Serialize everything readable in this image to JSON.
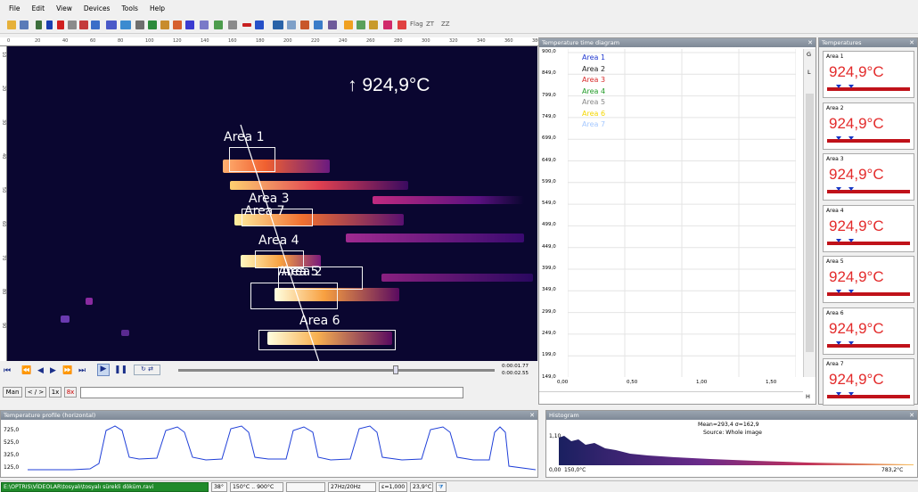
{
  "menu": [
    "File",
    "Edit",
    "View",
    "Devices",
    "Tools",
    "Help"
  ],
  "toolbar": {
    "flag_label": "Flag",
    "trail_a": "ZT",
    "trail_b": "ZZ"
  },
  "ruler": {
    "ticks": [
      "0",
      "20",
      "40",
      "60",
      "80",
      "100",
      "120",
      "140",
      "160",
      "180",
      "200",
      "220",
      "240",
      "260",
      "280",
      "300",
      "320",
      "340",
      "360",
      "380"
    ]
  },
  "vruler": {
    "ticks": [
      "10",
      "20",
      "30",
      "40",
      "50",
      "60",
      "70",
      "80",
      "90"
    ]
  },
  "thermal": {
    "max_readout": "↑ 924,9°C",
    "areas": [
      {
        "label": "Area 1"
      },
      {
        "label": "Area 3"
      },
      {
        "label": "Area 7"
      },
      {
        "label": "Area 4"
      },
      {
        "label": "Area 5"
      },
      {
        "label": "Area 2"
      },
      {
        "label": "Area 6"
      }
    ]
  },
  "playback": {
    "time_total": "0:00:01.77",
    "time_current": "0:00:02.55"
  },
  "nav": {
    "mode": "Man",
    "step": "< / >",
    "frame": "1x",
    "speed": "8x"
  },
  "ttd": {
    "title": "Temperature time diagram",
    "y_labels": [
      "900,0",
      "849,0",
      "799,0",
      "749,0",
      "699,0",
      "649,0",
      "599,0",
      "549,0",
      "499,0",
      "449,0",
      "399,0",
      "349,0",
      "299,0",
      "249,0",
      "199,0",
      "149,0"
    ],
    "x_labels": [
      "0,00",
      "0,50",
      "1,00",
      "1,50"
    ],
    "legend": [
      {
        "name": "Area 1",
        "color": "#2038d0"
      },
      {
        "name": "Area 2",
        "color": "#222222"
      },
      {
        "name": "Area 3",
        "color": "#d82b2b"
      },
      {
        "name": "Area 4",
        "color": "#1f9a25"
      },
      {
        "name": "Area 5",
        "color": "#888888"
      },
      {
        "name": "Area 6",
        "color": "#f4d600"
      },
      {
        "name": "Area 7",
        "color": "#a5c8ff"
      }
    ],
    "side_g": "G",
    "side_l": "L",
    "side_h": "H"
  },
  "temps": {
    "title": "Temperatures",
    "items": [
      {
        "name": "Area 1",
        "value": "924,9°C"
      },
      {
        "name": "Area 2",
        "value": "924,9°C"
      },
      {
        "name": "Area 3",
        "value": "924,9°C"
      },
      {
        "name": "Area 4",
        "value": "924,9°C"
      },
      {
        "name": "Area 5",
        "value": "924,9°C"
      },
      {
        "name": "Area 6",
        "value": "924,9°C"
      },
      {
        "name": "Area 7",
        "value": "924,9°C"
      }
    ]
  },
  "profile": {
    "title": "Temperature profile (horizontal)",
    "y_labels": [
      "725,0",
      "525,0",
      "325,0",
      "125,0"
    ]
  },
  "hist": {
    "title": "Histogram",
    "mean": "Mean=293,4 σ=162,9",
    "source": "Source: Whole image",
    "y_top": "1,10",
    "y_bottom": "0,00",
    "x_min": "150,0°C",
    "x_max": "783,2°C"
  },
  "status": {
    "path": "E:\\OPTRIS\\VİDEOLAR\\tosyalı\\tosyalı sürekli döküm.ravi",
    "fov": "38°",
    "range": "150°C .. 900°C",
    "blank": "",
    "rate": "27Hz/20Hz",
    "emissivity": "ε=1,000",
    "ambient": "23,9°C"
  },
  "colors": {
    "accent": "#2038d0",
    "temp_red": "#e32b2b",
    "title_bar": "#8893a0"
  }
}
